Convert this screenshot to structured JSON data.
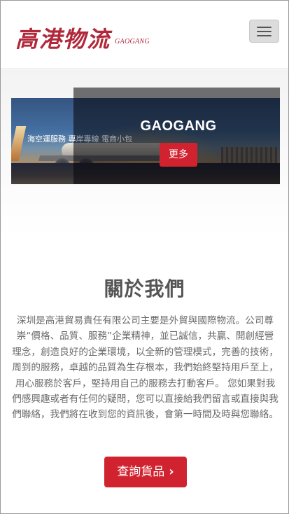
{
  "header": {
    "logo_cn": "高港物流",
    "logo_en": "GAOGANG",
    "menu_icon": "hamburger-menu-icon"
  },
  "banner": {
    "marquee_text": "海空運服務 專",
    "marquee_ghost": "岸專線 電商小包",
    "title": "GAOGANG",
    "more_label": "更多"
  },
  "about": {
    "title": "關於我們",
    "body": "深圳是高港貿易責任有限公司主要是外貿與國際物流。公司尊崇“價格、品質、服務”企業精神，並已誠信，共贏、開創經營理念，創造良好的企業環境，以全新的管理模式，完善的技術，周到的服務，卓越的品質為生存根本，我們始終堅持用戶至上，用心服務於客戶，堅持用自己的服務去打動客戶。 您如果對我們感興趣或者有任何的疑問，您可以直接給我們留言或直接與我們聯絡，我們將在收到您的資訊後，會第一時間及時與您聯絡。",
    "query_label": "查詢貨品",
    "query_icon": "chevron-right-icon"
  },
  "colors": {
    "brand_red": "#d1232f",
    "logo_red": "#b0283a"
  }
}
